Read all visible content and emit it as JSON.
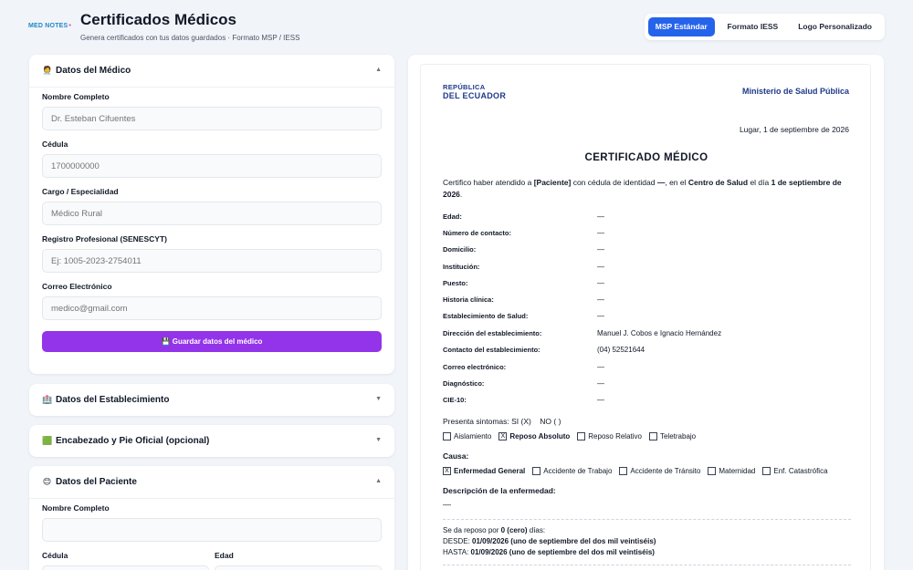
{
  "header": {
    "brand": "MED NOTES",
    "brand_dot": "•",
    "title": "Certificados Médicos",
    "subtitle": "Genera certificados con tus datos guardados · Formato MSP / IESS",
    "tabs": [
      {
        "label": "MSP Estándar",
        "active": true
      },
      {
        "label": "Formato IESS",
        "active": false
      },
      {
        "label": "Logo Personalizado",
        "active": false
      }
    ]
  },
  "doctor": {
    "title": "Datos del Médico",
    "emoji": "🧑‍⚕️",
    "fields": [
      {
        "label": "Nombre Completo",
        "placeholder": "Dr. Esteban Cifuentes"
      },
      {
        "label": "Cédula",
        "placeholder": "1700000000"
      },
      {
        "label": "Cargo / Especialidad",
        "placeholder": "Médico Rural"
      },
      {
        "label": "Registro Profesional (SENESCYT)",
        "placeholder": "Ej: 1005-2023-2754011"
      },
      {
        "label": "Correo Electrónico",
        "placeholder": "medico@gmail.com"
      }
    ],
    "save_label": "💾 Guardar datos del médico"
  },
  "establishment": {
    "title": "Datos del Establecimiento",
    "emoji": "🏥"
  },
  "letterhead": {
    "title": "Encabezado y Pie Oficial (opcional)",
    "emoji": "🟩"
  },
  "patient": {
    "title": "Datos del Paciente",
    "emoji": "😊",
    "name_label": "Nombre Completo",
    "id_label": "Cédula",
    "age_label": "Edad"
  },
  "certificate": {
    "republic_line1": "REPÚBLICA",
    "republic_line2": "DEL ECUADOR",
    "ministry": "Ministerio de Salud Pública",
    "place_date": "Lugar, 1 de septiembre de 2026",
    "title": "CERTIFICADO MÉDICO",
    "intro_1": "Certifico haber atendido a ",
    "intro_patient": "[Paciente]",
    "intro_2": " con cédula de identidad ",
    "intro_id": "—",
    "intro_3": ", en el ",
    "intro_center": "Centro de Salud",
    "intro_4": " el día ",
    "intro_date": "1 de septiembre de 2026",
    "intro_5": ".",
    "rows": [
      {
        "label": "Edad:",
        "value": "—"
      },
      {
        "label": "Número de contacto:",
        "value": "—"
      },
      {
        "label": "Domicilio:",
        "value": "—"
      },
      {
        "label": "Institución:",
        "value": "—"
      },
      {
        "label": "Puesto:",
        "value": "—"
      },
      {
        "label": "Historia clínica:",
        "value": "—"
      },
      {
        "label": "Establecimiento de Salud:",
        "value": "—"
      },
      {
        "label": "Dirección del establecimiento:",
        "value": "Manuel J. Cobos e Ignacio Hernández"
      },
      {
        "label": "Contacto del establecimiento:",
        "value": "(04) 52521644"
      },
      {
        "label": "Correo electrónico:",
        "value": "—"
      },
      {
        "label": "Diagnóstico:",
        "value": "—"
      },
      {
        "label": "CIE-10:",
        "value": "—"
      }
    ],
    "symptoms": "Presenta sintomas: SI (X)    NO ( )",
    "rest_types": [
      {
        "label": "Aislamiento",
        "checked": false
      },
      {
        "label": "Reposo Absoluto",
        "checked": true
      },
      {
        "label": "Reposo Relativo",
        "checked": false
      },
      {
        "label": "Teletrabajo",
        "checked": false
      }
    ],
    "cause_label": "Causa:",
    "causes": [
      {
        "label": "Enfermedad General",
        "checked": true
      },
      {
        "label": "Accidente de Trabajo",
        "checked": false
      },
      {
        "label": "Accidente de Tránsito",
        "checked": false
      },
      {
        "label": "Maternidad",
        "checked": false
      },
      {
        "label": "Enf. Catastrófica",
        "checked": false
      }
    ],
    "check_mark": "X",
    "description_label": "Descripción de la enfermedad:",
    "description_value": "—",
    "rest_days_1": "Se da reposo por ",
    "rest_days_value": "0 (cero)",
    "rest_days_2": " días:",
    "from_label": "DESDE: ",
    "from_value": "01/09/2026 (uno de septiembre del dos mil veintiséis)",
    "to_label": "HASTA: ",
    "to_value": "01/09/2026 (uno de septiembre del dos mil veintiséis)"
  }
}
